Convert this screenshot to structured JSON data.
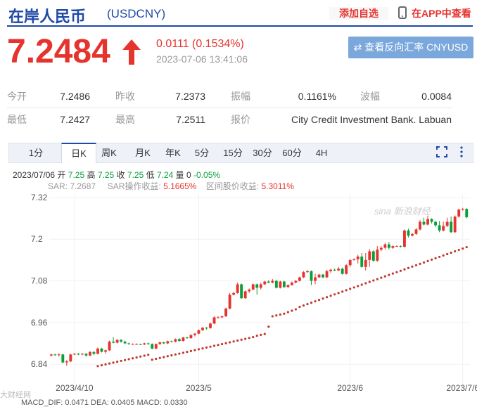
{
  "header": {
    "title": "在岸人民币",
    "code": "(USDCNY)",
    "watch_label": "添加自选",
    "app_label": "在APP中查看"
  },
  "quote": {
    "price": "7.2484",
    "change": "0.0111 (0.1534%)",
    "time": "2023-07-06 13:41:06",
    "reverse_btn": "⇄ 查看反向汇率 CNYUSD",
    "direction": "up",
    "up_color": "#e5342e"
  },
  "stats": {
    "row1": [
      {
        "label": "今开",
        "value": "7.2486"
      },
      {
        "label": "昨收",
        "value": "7.2373"
      },
      {
        "label": "振幅",
        "value": "0.1161%"
      },
      {
        "label": "波幅",
        "value": "0.0084"
      }
    ],
    "row2": [
      {
        "label": "最低",
        "value": "7.2427"
      },
      {
        "label": "最高",
        "value": "7.2511"
      },
      {
        "label": "报价",
        "value": "City Credit Investment Bank. Labuan"
      }
    ]
  },
  "tabs": [
    "1分",
    "日K",
    "周K",
    "月K",
    "年K",
    "5分",
    "15分",
    "30分",
    "60分",
    "4H"
  ],
  "active_tab": 1,
  "info": {
    "date": "2023/07/06",
    "open_l": "开",
    "open": "7.25",
    "high_l": "高",
    "high": "7.25",
    "close_l": "收",
    "close": "7.25",
    "low_l": "低",
    "low": "7.24",
    "vol_l": "量",
    "vol": "0",
    "pct": "-0.05%",
    "sar": "SAR: 7.2687",
    "sar_profit_l": "SAR操作收益:",
    "sar_profit": "5.1665%",
    "range_profit_l": "区间股价收益:",
    "range_profit": "5.3011%"
  },
  "watermark": "sina 新浪财经",
  "watermark2": "大财经网",
  "macd_text": "MACD_DIF: 0.0471    DEA: 0.0405    MACD: 0.0330",
  "chart_data": {
    "type": "candlestick",
    "y_ticks": [
      "7.32",
      "7.2",
      "7.08",
      "6.96",
      "6.84"
    ],
    "y_tick_values": [
      7.32,
      7.2,
      7.08,
      6.96,
      6.84
    ],
    "x_ticks": [
      "2023/4/10",
      "2023/5",
      "2023/6",
      "2023/7/6"
    ],
    "ylim": [
      6.82,
      7.33
    ],
    "up_color": "#e5342e",
    "down_color": "#0a9e3c",
    "sar_color": "#c0392b",
    "candles": [
      [
        6.865,
        6.868,
        6.862,
        6.87
      ],
      [
        6.868,
        6.866,
        6.864,
        6.87
      ],
      [
        6.866,
        6.868,
        6.862,
        6.872
      ],
      [
        6.868,
        6.845,
        6.843,
        6.87
      ],
      [
        6.845,
        6.848,
        6.835,
        6.852
      ],
      [
        6.848,
        6.868,
        6.846,
        6.87
      ],
      [
        6.868,
        6.87,
        6.866,
        6.872
      ],
      [
        6.87,
        6.868,
        6.866,
        6.872
      ],
      [
        6.868,
        6.87,
        6.866,
        6.872
      ],
      [
        6.87,
        6.865,
        6.862,
        6.872
      ],
      [
        6.865,
        6.875,
        6.863,
        6.878
      ],
      [
        6.875,
        6.87,
        6.866,
        6.878
      ],
      [
        6.87,
        6.885,
        6.868,
        6.888
      ],
      [
        6.885,
        6.876,
        6.874,
        6.887
      ],
      [
        6.876,
        6.88,
        6.87,
        6.882
      ],
      [
        6.88,
        6.905,
        6.878,
        6.908
      ],
      [
        6.905,
        6.902,
        6.9,
        6.918
      ],
      [
        6.902,
        6.91,
        6.9,
        6.912
      ],
      [
        6.91,
        6.905,
        6.902,
        6.912
      ],
      [
        6.905,
        6.9,
        6.898,
        6.908
      ],
      [
        6.9,
        6.898,
        6.896,
        6.902
      ],
      [
        6.898,
        6.898,
        6.896,
        6.9
      ],
      [
        6.898,
        6.898,
        6.896,
        6.9
      ],
      [
        6.898,
        6.897,
        6.895,
        6.899
      ],
      [
        6.897,
        6.9,
        6.895,
        6.902
      ],
      [
        6.9,
        6.898,
        6.896,
        6.902
      ],
      [
        6.898,
        6.885,
        6.883,
        6.9
      ],
      [
        6.885,
        6.898,
        6.883,
        6.9
      ],
      [
        6.898,
        6.903,
        6.896,
        6.905
      ],
      [
        6.903,
        6.9,
        6.898,
        6.905
      ],
      [
        6.9,
        6.906,
        6.898,
        6.908
      ],
      [
        6.906,
        6.905,
        6.903,
        6.908
      ],
      [
        6.905,
        6.912,
        6.903,
        6.914
      ],
      [
        6.912,
        6.907,
        6.905,
        6.915
      ],
      [
        6.907,
        6.917,
        6.905,
        6.919
      ],
      [
        6.917,
        6.915,
        6.913,
        6.919
      ],
      [
        6.915,
        6.924,
        6.913,
        6.926
      ],
      [
        6.924,
        6.928,
        6.92,
        6.93
      ],
      [
        6.928,
        6.938,
        6.926,
        6.94
      ],
      [
        6.938,
        6.945,
        6.936,
        6.947
      ],
      [
        6.945,
        6.944,
        6.94,
        6.947
      ],
      [
        6.944,
        6.957,
        6.942,
        6.96
      ],
      [
        6.957,
        6.975,
        6.955,
        6.978
      ],
      [
        6.975,
        6.975,
        6.972,
        6.978
      ],
      [
        6.975,
        6.978,
        6.972,
        6.98
      ],
      [
        6.978,
        7.0,
        6.976,
        7.003
      ],
      [
        7.0,
        7.04,
        6.998,
        7.045
      ],
      [
        7.04,
        7.045,
        7.038,
        7.048
      ],
      [
        7.045,
        7.07,
        7.043,
        7.075
      ],
      [
        7.07,
        7.03,
        7.028,
        7.072
      ],
      [
        7.03,
        7.05,
        7.028,
        7.052
      ],
      [
        7.05,
        7.055,
        7.045,
        7.058
      ],
      [
        7.055,
        7.07,
        7.053,
        7.072
      ],
      [
        7.07,
        7.06,
        7.04,
        7.072
      ],
      [
        7.06,
        7.07,
        7.055,
        7.075
      ],
      [
        7.07,
        7.078,
        7.068,
        7.08
      ],
      [
        7.078,
        7.075,
        7.073,
        7.082
      ],
      [
        7.075,
        7.08,
        7.073,
        7.085
      ],
      [
        7.08,
        7.06,
        7.058,
        7.082
      ],
      [
        7.06,
        7.078,
        7.058,
        7.08
      ],
      [
        7.078,
        7.062,
        7.06,
        7.08
      ],
      [
        7.062,
        7.068,
        7.06,
        7.07
      ],
      [
        7.068,
        7.075,
        7.066,
        7.078
      ],
      [
        7.075,
        7.08,
        7.073,
        7.082
      ],
      [
        7.08,
        7.09,
        7.078,
        7.092
      ],
      [
        7.09,
        7.105,
        7.088,
        7.108
      ],
      [
        7.105,
        7.108,
        7.103,
        7.11
      ],
      [
        7.108,
        7.08,
        7.068,
        7.11
      ],
      [
        7.08,
        7.09,
        7.07,
        7.1
      ],
      [
        7.09,
        7.098,
        7.088,
        7.1
      ],
      [
        7.098,
        7.09,
        7.088,
        7.1
      ],
      [
        7.09,
        7.108,
        7.088,
        7.112
      ],
      [
        7.108,
        7.112,
        7.103,
        7.115
      ],
      [
        7.112,
        7.11,
        7.108,
        7.115
      ],
      [
        7.11,
        7.115,
        7.108,
        7.12
      ],
      [
        7.115,
        7.1,
        7.098,
        7.118
      ],
      [
        7.1,
        7.125,
        7.098,
        7.128
      ],
      [
        7.125,
        7.14,
        7.12,
        7.142
      ],
      [
        7.14,
        7.142,
        7.138,
        7.145
      ],
      [
        7.142,
        7.15,
        7.13,
        7.155
      ],
      [
        7.15,
        7.12,
        7.118,
        7.16
      ],
      [
        7.12,
        7.14,
        7.11,
        7.16
      ],
      [
        7.14,
        7.165,
        7.12,
        7.172
      ],
      [
        7.165,
        7.138,
        7.135,
        7.168
      ],
      [
        7.138,
        7.17,
        7.135,
        7.18
      ],
      [
        7.17,
        7.175,
        7.165,
        7.18
      ],
      [
        7.175,
        7.185,
        7.17,
        7.19
      ],
      [
        7.185,
        7.175,
        7.17,
        7.192
      ],
      [
        7.175,
        7.18,
        7.172,
        7.182
      ],
      [
        7.18,
        7.18,
        7.178,
        7.182
      ],
      [
        7.18,
        7.178,
        7.176,
        7.182
      ],
      [
        7.178,
        7.225,
        7.176,
        7.228
      ],
      [
        7.225,
        7.21,
        7.205,
        7.23
      ],
      [
        7.21,
        7.215,
        7.208,
        7.218
      ],
      [
        7.215,
        7.228,
        7.212,
        7.232
      ],
      [
        7.228,
        7.25,
        7.225,
        7.255
      ],
      [
        7.25,
        7.242,
        7.24,
        7.262
      ],
      [
        7.242,
        7.258,
        7.24,
        7.268
      ],
      [
        7.258,
        7.25,
        7.245,
        7.26
      ],
      [
        7.25,
        7.24,
        7.235,
        7.252
      ],
      [
        7.24,
        7.225,
        7.22,
        7.252
      ],
      [
        7.225,
        7.238,
        7.222,
        7.25
      ],
      [
        7.238,
        7.25,
        7.235,
        7.262
      ],
      [
        7.25,
        7.22,
        7.218,
        7.265
      ],
      [
        7.22,
        7.265,
        7.218,
        7.268
      ],
      [
        7.265,
        7.285,
        7.262,
        7.288
      ],
      [
        7.285,
        7.287,
        7.282,
        7.29
      ],
      [
        7.287,
        7.263,
        7.26,
        7.289
      ]
    ],
    "sar": [
      null,
      null,
      null,
      null,
      null,
      null,
      null,
      null,
      null,
      null,
      null,
      null,
      null,
      null,
      null,
      null,
      null,
      null,
      null,
      null,
      null,
      null,
      null,
      null,
      null,
      null,
      null,
      null,
      null,
      null,
      null,
      null,
      null,
      null,
      null,
      null,
      null,
      null,
      null,
      null,
      null,
      null,
      null,
      null,
      null,
      null,
      null,
      null,
      null,
      null,
      null,
      null,
      null,
      null,
      null,
      null,
      null,
      null,
      null,
      null,
      null,
      null,
      null,
      null,
      null,
      null,
      null,
      null,
      null,
      null,
      null,
      null,
      null,
      null,
      null,
      null,
      null,
      null,
      null,
      null,
      null,
      null,
      null,
      null,
      null,
      null,
      null,
      null,
      null,
      null,
      null,
      null,
      null,
      null,
      null,
      null,
      null,
      null,
      null,
      null,
      null,
      null,
      null,
      null,
      null,
      null,
      null,
      null
    ]
  }
}
